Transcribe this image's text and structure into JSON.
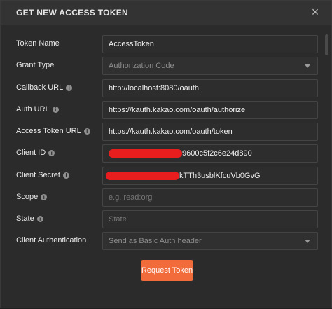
{
  "dialog": {
    "title": "GET NEW ACCESS TOKEN",
    "close_glyph": "×"
  },
  "fields": {
    "token_name": {
      "label": "Token Name",
      "value": "AccessToken"
    },
    "grant_type": {
      "label": "Grant Type",
      "value": "Authorization Code"
    },
    "callback_url": {
      "label": "Callback URL",
      "value": "http://localhost:8080/oauth"
    },
    "auth_url": {
      "label": "Auth URL",
      "value": "https://kauth.kakao.com/oauth/authorize"
    },
    "access_token_url": {
      "label": "Access Token URL",
      "value": "https://kauth.kakao.com/oauth/token"
    },
    "client_id": {
      "label": "Client ID",
      "value": "9600c5f2c6e24d890"
    },
    "client_secret": {
      "label": "Client Secret",
      "value": "kTTh3usblKfcuVb0GvG"
    },
    "scope": {
      "label": "Scope",
      "placeholder": "e.g. read:org"
    },
    "state": {
      "label": "State",
      "placeholder": "State"
    },
    "client_auth": {
      "label": "Client Authentication",
      "value": "Send as Basic Auth header"
    }
  },
  "actions": {
    "request_token": "Request Token"
  },
  "colors": {
    "accent": "#f26b3a",
    "background": "#2b2b2b",
    "redaction": "#e81e1e"
  },
  "icons": {
    "info": "i"
  }
}
